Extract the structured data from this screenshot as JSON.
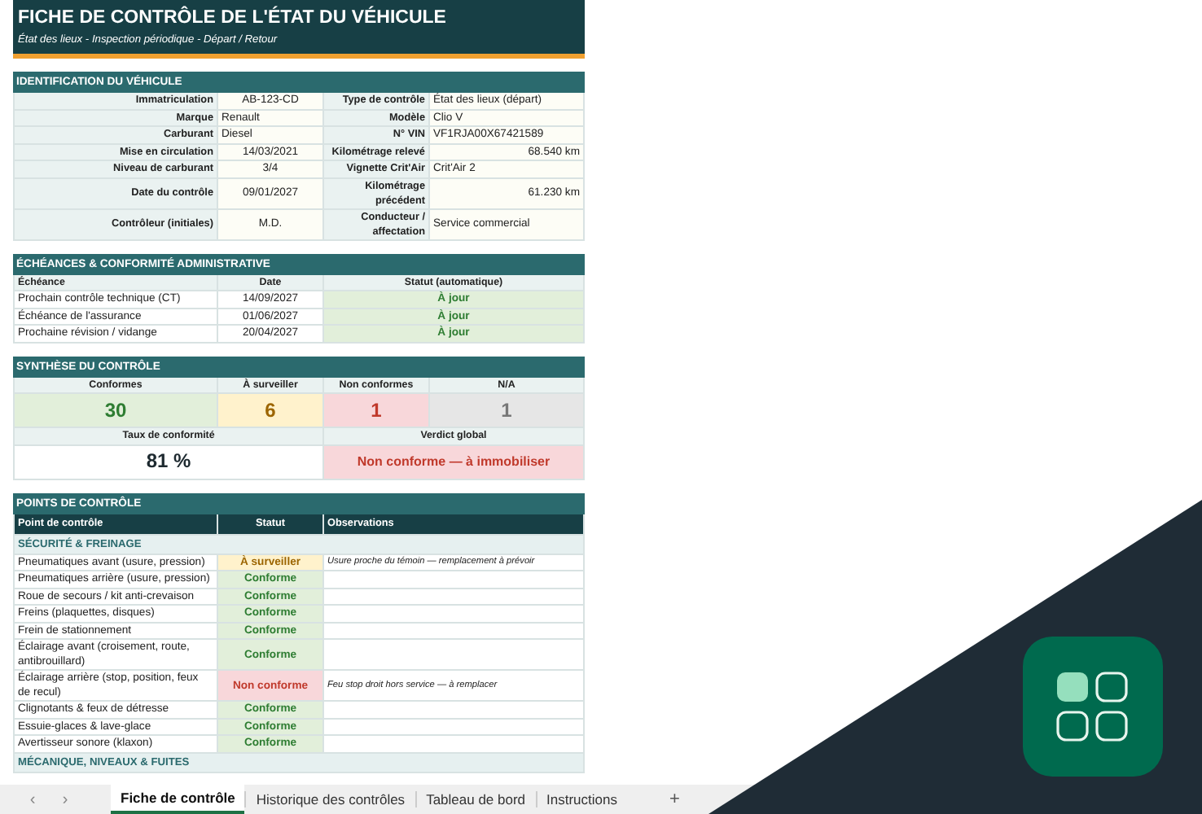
{
  "header": {
    "title": "FICHE DE CONTRÔLE DE L'ÉTAT DU VÉHICULE",
    "subtitle": "État des lieux - Inspection périodique - Départ / Retour"
  },
  "identification": {
    "title": "IDENTIFICATION DU VÉHICULE",
    "rows": [
      {
        "cells": [
          {
            "label": "Immatriculation",
            "value": "AB-123-CD",
            "kind": "code"
          },
          {
            "label": "Type de contrôle",
            "value": "État des lieux (départ)",
            "kind": "text"
          }
        ]
      },
      {
        "cells": [
          {
            "label": "Marque",
            "value": "Renault",
            "kind": "text"
          },
          {
            "label": "Modèle",
            "value": "Clio V",
            "kind": "text"
          }
        ]
      },
      {
        "cells": [
          {
            "label": "Carburant",
            "value": "Diesel",
            "kind": "text"
          },
          {
            "label": "N° VIN",
            "value": "VF1RJA00X67421589",
            "kind": "text"
          }
        ]
      },
      {
        "cells": [
          {
            "label": "Mise en circulation",
            "value": "14/03/2021",
            "kind": "code"
          },
          {
            "label": "Kilométrage relevé",
            "value": "68.540 km",
            "kind": "number"
          }
        ]
      },
      {
        "cells": [
          {
            "label": "Niveau de carburant",
            "value": "3/4",
            "kind": "code"
          },
          {
            "label": "Vignette Crit'Air",
            "value": "Crit'Air 2",
            "kind": "text"
          }
        ]
      },
      {
        "cells": [
          {
            "label": "Date du contrôle",
            "value": "09/01/2027",
            "kind": "code"
          },
          {
            "label": "Kilométrage précédent",
            "value": "61.230 km",
            "kind": "number"
          }
        ]
      },
      {
        "cells": [
          {
            "label": "Contrôleur (initiales)",
            "value": "M.D.",
            "kind": "code"
          },
          {
            "label": "Conducteur / affectation",
            "value": "Service commercial",
            "kind": "text"
          }
        ]
      }
    ]
  },
  "deadlines": {
    "title": "ÉCHÉANCES & CONFORMITÉ ADMINISTRATIVE",
    "columns": [
      "Échéance",
      "Date",
      "Statut (automatique)"
    ],
    "rows": [
      {
        "name": "Prochain contrôle technique (CT)",
        "date": "14/09/2027",
        "status": "À jour",
        "kind": "ok"
      },
      {
        "name": "Échéance de l'assurance",
        "date": "01/06/2027",
        "status": "À jour",
        "kind": "ok"
      },
      {
        "name": "Prochaine révision / vidange",
        "date": "20/04/2027",
        "status": "À jour",
        "kind": "ok"
      }
    ]
  },
  "summary": {
    "title": "SYNTHÈSE DU CONTRÔLE",
    "counts": [
      {
        "label": "Conformes",
        "value": "30",
        "kind": "ok"
      },
      {
        "label": "À surveiller",
        "value": "6",
        "kind": "watch"
      },
      {
        "label": "Non conformes",
        "value": "1",
        "kind": "fail"
      },
      {
        "label": "N/A",
        "value": "1",
        "kind": "na"
      }
    ],
    "rate": {
      "label": "Taux de conformité",
      "value": "81 %"
    },
    "verdict": {
      "label": "Verdict global",
      "value": "Non conforme — à immobiliser",
      "kind": "fail"
    }
  },
  "checkpoints": {
    "title": "POINTS DE CONTRÔLE",
    "columns": [
      "Point de contrôle",
      "Statut",
      "Observations"
    ],
    "groups": [
      {
        "title": "SÉCURITÉ & FREINAGE",
        "items": [
          {
            "point": "Pneumatiques avant (usure, pression)",
            "status": "À surveiller",
            "kind": "watch",
            "observation": "Usure proche du témoin — remplacement à prévoir"
          },
          {
            "point": "Pneumatiques arrière (usure, pression)",
            "status": "Conforme",
            "kind": "ok"
          },
          {
            "point": "Roue de secours / kit anti-crevaison",
            "status": "Conforme",
            "kind": "ok"
          },
          {
            "point": "Freins (plaquettes, disques)",
            "status": "Conforme",
            "kind": "ok"
          },
          {
            "point": "Frein de stationnement",
            "status": "Conforme",
            "kind": "ok"
          },
          {
            "point": "Éclairage avant (croisement, route, antibrouillard)",
            "status": "Conforme",
            "kind": "ok"
          },
          {
            "point": "Éclairage arrière (stop, position, feux de recul)",
            "status": "Non conforme",
            "kind": "fail",
            "observation": "Feu stop droit hors service — à remplacer"
          },
          {
            "point": "Clignotants & feux de détresse",
            "status": "Conforme",
            "kind": "ok"
          },
          {
            "point": "Essuie-glaces & lave-glace",
            "status": "Conforme",
            "kind": "ok"
          },
          {
            "point": "Avertisseur sonore (klaxon)",
            "status": "Conforme",
            "kind": "ok"
          }
        ]
      },
      {
        "title": "MÉCANIQUE, NIVEAUX & FUITES"
      }
    ]
  },
  "sheet_tabs": {
    "nav": [
      "‹",
      "›"
    ],
    "tabs": [
      {
        "label": "Fiche de contrôle",
        "selected": true
      },
      {
        "label": "Historique des contrôles",
        "selected": false
      },
      {
        "label": "Tableau de bord",
        "selected": false
      },
      {
        "label": "Instructions",
        "selected": false
      }
    ],
    "add": "+"
  }
}
